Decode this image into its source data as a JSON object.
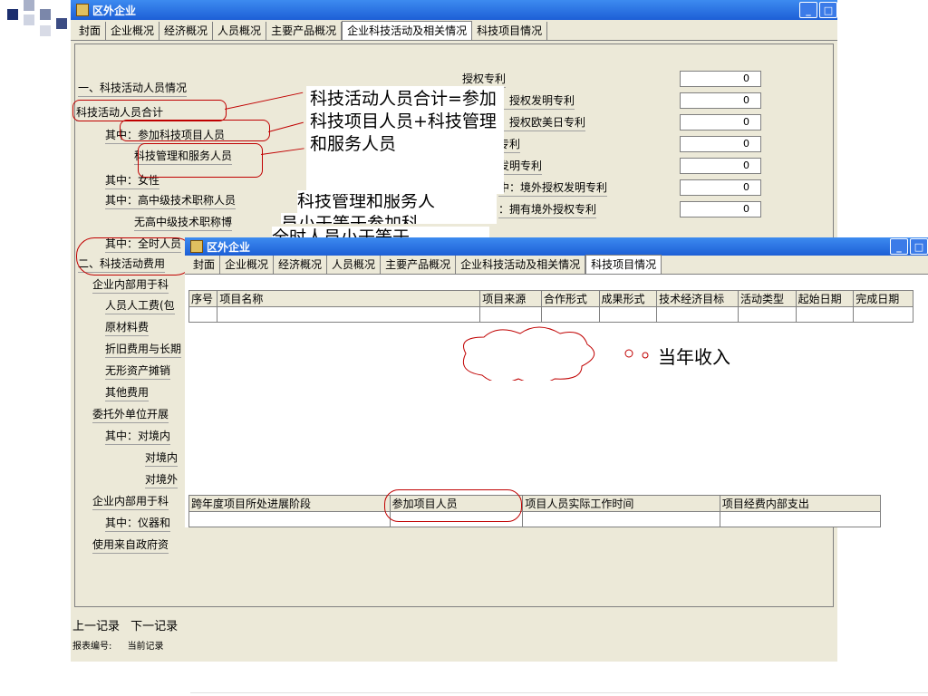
{
  "win1": {
    "title": "区外企业",
    "tabs": [
      "封面",
      "企业概况",
      "经济概况",
      "人员概况",
      "主要产品概况",
      "企业科技活动及相关情况",
      "科技项目情况"
    ],
    "active_tab_index": 5,
    "left_items": [
      "一、科技活动人员情况",
      "科技活动人员合计",
      "其中：参加科技项目人员",
      "科技管理和服务人员",
      "其中：女性",
      "其中：高中级技术职称人员",
      "无高中级技术职称博",
      "其中：全时人员",
      "二、科技活动费用",
      "企业内部用于科",
      "人员人工费(包",
      "原材料费",
      "折旧费用与长期",
      "无形资产摊销",
      "其他费用",
      "委托外单位开展",
      "其中：对境内",
      "对境内",
      "对境外",
      "企业内部用于科",
      "其中：仪器和",
      "使用来自政府资"
    ],
    "right_items": [
      {
        "label": "授权专利",
        "value": "0"
      },
      {
        "label": "：授权发明专利",
        "value": "0"
      },
      {
        "label": "：授权欧美日专利",
        "value": "0"
      },
      {
        "label": "专利",
        "value": "0"
      },
      {
        "label": "发明专利",
        "value": "0"
      },
      {
        "label": "中：境外授权发明专利",
        "value": "0"
      },
      {
        "label": "：拥有境外授权专利",
        "value": "0"
      }
    ],
    "nav": {
      "prev": "上一记录",
      "next": "下一记录"
    },
    "status": {
      "report_no": "报表编号:",
      "current": "当前记录"
    }
  },
  "callouts": {
    "main": "科技活动人员合计=参加科技项目人员+科技管理和服务人员",
    "behind1": "科技管理和服务人",
    "behind2": "员小于等于参加科",
    "behind3": "全时人员小于等于",
    "annual_income": "当年收入"
  },
  "win2": {
    "title": "区外企业",
    "tabs": [
      "封面",
      "企业概况",
      "经济概况",
      "人员概况",
      "主要产品概况",
      "企业科技活动及相关情况",
      "科技项目情况"
    ],
    "active_tab_index": 6,
    "table_headers": [
      "序号",
      "项目名称",
      "项目来源",
      "合作形式",
      "成果形式",
      "技术经济目标",
      "活动类型",
      "起始日期",
      "完成日期"
    ],
    "table2_headers": [
      "跨年度项目所处进展阶段",
      "参加项目人员",
      "项目人员实际工作时间",
      "项目经费内部支出"
    ]
  }
}
